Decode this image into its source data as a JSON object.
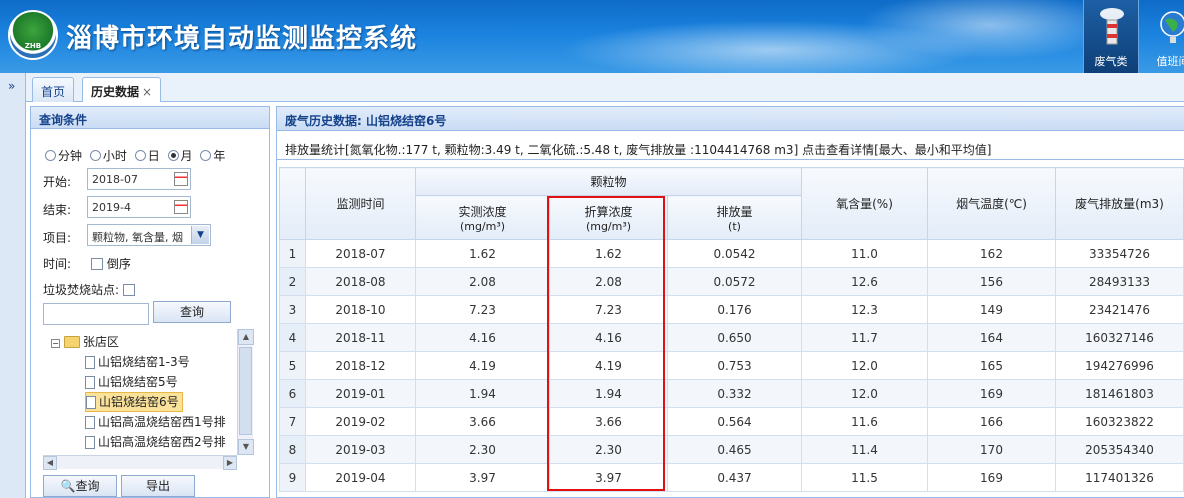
{
  "header": {
    "title": "淄博市环境自动监测监控系统",
    "logo_text": "ZHB",
    "buttons": [
      {
        "label": "废气类",
        "active": true
      },
      {
        "label": "值班间",
        "active": false
      }
    ]
  },
  "tabs": [
    {
      "label": "首页"
    },
    {
      "label": "历史数据",
      "close": "×"
    }
  ],
  "collapse_glyph": "»",
  "query": {
    "title": "查询条件",
    "granularity": [
      {
        "label": "分钟",
        "selected": false
      },
      {
        "label": "小时",
        "selected": false
      },
      {
        "label": "日",
        "selected": false
      },
      {
        "label": "月",
        "selected": true
      },
      {
        "label": "年",
        "selected": false
      }
    ],
    "start_label": "开始:",
    "start_value": "2018-07",
    "end_label": "结束:",
    "end_value": "2019-4",
    "items_label": "项目:",
    "items_value": "颗粒物, 氧含量, 烟",
    "time_label": "时间:",
    "reverse_label": "倒序",
    "station_label": "垃圾焚烧站点:",
    "search_button": "查询",
    "tree": {
      "root": "张店区",
      "minus": "−",
      "children": [
        {
          "label": "山铝烧结窑1-3号",
          "selected": false
        },
        {
          "label": "山铝烧结窑5号",
          "selected": false
        },
        {
          "label": "山铝烧结窑6号",
          "selected": true
        },
        {
          "label": "山铝高温烧结窑西1号排",
          "selected": false
        },
        {
          "label": "山铝高温烧结窑西2号排",
          "selected": false
        }
      ]
    },
    "query_button": "查询",
    "export_button": "导出"
  },
  "history": {
    "title": "废气历史数据: 山铝烧结窑6号",
    "stats": "排放量统计[氮氧化物.:177 t, 颗粒物:3.49 t, 二氧化硫.:5.48 t, 废气排放量 :1104414768 m3] 点击查看详情[最大、最小和平均值]",
    "columns": {
      "time": "监测时间",
      "group": "颗粒物",
      "measured": "实测浓度",
      "measured_unit": "(mg/m³)",
      "converted": "折算浓度",
      "converted_unit": "(mg/m³)",
      "emission": "排放量",
      "emission_unit": "(t)",
      "oxygen": "氧含量(%)",
      "temp": "烟气温度(℃)",
      "gas": "废气排放量(m3)"
    },
    "rows": [
      {
        "n": "1",
        "time": "2018-07",
        "measured": "1.62",
        "converted": "1.62",
        "emission": "0.0542",
        "oxygen": "11.0",
        "temp": "162",
        "gas": "33354726"
      },
      {
        "n": "2",
        "time": "2018-08",
        "measured": "2.08",
        "converted": "2.08",
        "emission": "0.0572",
        "oxygen": "12.6",
        "temp": "156",
        "gas": "28493133"
      },
      {
        "n": "3",
        "time": "2018-10",
        "measured": "7.23",
        "converted": "7.23",
        "emission": "0.176",
        "oxygen": "12.3",
        "temp": "149",
        "gas": "23421476"
      },
      {
        "n": "4",
        "time": "2018-11",
        "measured": "4.16",
        "converted": "4.16",
        "emission": "0.650",
        "oxygen": "11.7",
        "temp": "164",
        "gas": "160327146"
      },
      {
        "n": "5",
        "time": "2018-12",
        "measured": "4.19",
        "converted": "4.19",
        "emission": "0.753",
        "oxygen": "12.0",
        "temp": "165",
        "gas": "194276996"
      },
      {
        "n": "6",
        "time": "2019-01",
        "measured": "1.94",
        "converted": "1.94",
        "emission": "0.332",
        "oxygen": "12.0",
        "temp": "169",
        "gas": "181461803"
      },
      {
        "n": "7",
        "time": "2019-02",
        "measured": "3.66",
        "converted": "3.66",
        "emission": "0.564",
        "oxygen": "11.6",
        "temp": "166",
        "gas": "160323822"
      },
      {
        "n": "8",
        "time": "2019-03",
        "measured": "2.30",
        "converted": "2.30",
        "emission": "0.465",
        "oxygen": "11.4",
        "temp": "170",
        "gas": "205354340"
      },
      {
        "n": "9",
        "time": "2019-04",
        "measured": "3.97",
        "converted": "3.97",
        "emission": "0.437",
        "oxygen": "11.5",
        "temp": "169",
        "gas": "117401326"
      }
    ]
  },
  "colors": {
    "header_blue": "#1a82de",
    "panel_border": "#99bbe8",
    "panel_title": "#15428b",
    "highlight_red": "#e21010"
  }
}
